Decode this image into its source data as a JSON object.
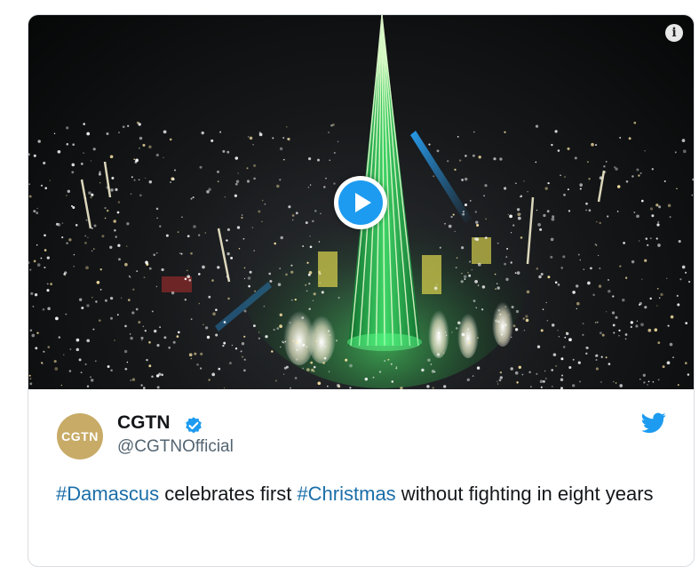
{
  "media": {
    "info_icon": "info-icon",
    "play_icon": "play-icon"
  },
  "author": {
    "avatar_text": "CGTN",
    "name": "CGTN",
    "handle": "@CGTNOfficial",
    "verified_icon": "verified-badge-icon"
  },
  "platform_icon": "twitter-bird-icon",
  "tweet": {
    "hashtag_1": "#Damascus",
    "text_1": " celebrates first ",
    "hashtag_2": "#Christmas",
    "text_2": " without fighting in eight years"
  },
  "colors": {
    "accent": "#1d9bf0",
    "hashtag": "#1b6ea8",
    "avatar_gold": "#c8ab67"
  }
}
